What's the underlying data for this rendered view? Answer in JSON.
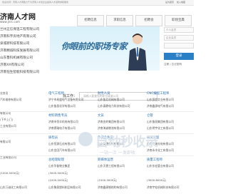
{
  "topbar": {
    "notice": "欢迎访问！济南人才网致力于为济南人才和企业提供人才招聘求职服务",
    "links": [
      "设为首页",
      "加入收藏"
    ]
  },
  "header": {
    "logo_title": "济南人才网",
    "logo_sub": "www.jnrc.com",
    "nav": [
      "招聘信息",
      "求职信息",
      "招聘会",
      "职场宝典"
    ]
  },
  "left_list": [
    "兰州正信保温工程有限公司",
    "济南科宇房地产有限公司",
    "泉城新科技有限公司",
    "济南精诚科技发展有限公司",
    "山东鲁科机械有限公司",
    "济南XX有限公司",
    "济南恒生智能科技有限公司"
  ],
  "banner": {
    "slogan": "你眼前的职场专家",
    "search_label": "找工作：",
    "search_placeholder": "请输入要查找的职位或者公司"
  },
  "login": {
    "username": "个人会员",
    "password": "企业会员",
    "field3": "",
    "button": "登录",
    "links": "注册 | 忘记密码"
  },
  "columns": [
    {
      "items": [
        "业务员",
        "汽车维修有限公司",
        "",
        "有限公司",
        "(下乡上门)",
        "工业有限公司",
        "",
        "有限公司",
        "",
        "工业有限公司",
        "",
        "(1000-5000元)",
        "",
        "山东万诚化工有限公司"
      ]
    },
    {
      "cat": [
        "电气工程师",
        "材料销售专员",
        "质检员",
        "总经理助理"
      ],
      "items": [
        "济宁市易盛电气设备有限公司",
        "",
        "山东鲁昌化学有限公司",
        "济南市恒丰机电有限公司",
        "济南德瑞电子有限公司",
        "山东恒源石化有限公司",
        "",
        "山东金田汽车有限公司",
        "山东华鲁物业集团",
        "(3000-5000元)",
        "(1000-5000元)",
        "山东聚昌塑料制品有限公司"
      ]
    },
    {
      "cat": [
        "财务人员",
        "文员",
        "外贸业务员",
        "新媒体运营"
      ],
      "items": [
        "山东鲁北机械有限公司",
        "",
        "山东泰鼎电力科技有限公司",
        "济南金岭集团有限公司",
        "济南海诚物流有限公司",
        "",
        "山东海德机械有限公司",
        "山东天德工程有限公司",
        "(1500-3000元)",
        "济南鑫源钢结构有限公司"
      ]
    },
    {
      "cat": [
        "CNC编程工程师",
        "仓管",
        "技术总监",
        "质量工程师"
      ],
      "items": [
        "山东国信实业有限公司",
        "济南鑫源电气有限公司",
        "",
        "山东鲁丽集团有限公司",
        "山东明宇化工有限公司",
        "山东中海光电有限公司",
        "",
        "济南永丰化工有限公司",
        "山东东宏管业有限公司",
        "(3000-8000元)",
        "济南宇宏机械科技有限公司"
      ]
    }
  ],
  "watermark": {
    "title": "自动秒收录",
    "sub": "一站一次 一发即收"
  }
}
